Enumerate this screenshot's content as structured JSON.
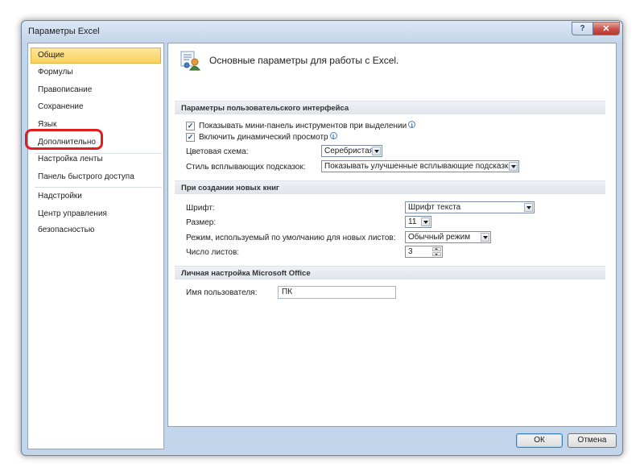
{
  "window": {
    "title": "Параметры Excel",
    "help_label": "?",
    "close_label": "✕"
  },
  "sidebar": {
    "items": [
      {
        "label": "Общие",
        "selected": true
      },
      {
        "label": "Формулы"
      },
      {
        "label": "Правописание"
      },
      {
        "label": "Сохранение"
      },
      {
        "label": "Язык"
      },
      {
        "label": "Дополнительно",
        "highlighted": true
      },
      {
        "label": "Настройка ленты"
      },
      {
        "label": "Панель быстрого доступа"
      },
      {
        "label": "Надстройки"
      },
      {
        "label": "Центр управления безопасностью"
      }
    ]
  },
  "header": {
    "title": "Основные параметры для работы с Excel."
  },
  "ui_section": {
    "title": "Параметры пользовательского интерфейса",
    "mini_toolbar": {
      "label": "Показывать мини-панель инструментов при выделении",
      "checked": true
    },
    "live_preview": {
      "label": "Включить динамический просмотр",
      "checked": true
    },
    "color_scheme": {
      "label": "Цветовая схема:",
      "value": "Серебристая"
    },
    "tooltip_style": {
      "label": "Стиль всплывающих подсказок:",
      "value": "Показывать улучшенные всплывающие подсказки"
    }
  },
  "new_workbook": {
    "title": "При создании новых книг",
    "font": {
      "label": "Шрифт:",
      "value": "Шрифт текста"
    },
    "size": {
      "label": "Размер:",
      "value": "11"
    },
    "default_view": {
      "label": "Режим, используемый по умолчанию для новых листов:",
      "value": "Обычный режим"
    },
    "sheets": {
      "label": "Число листов:",
      "value": "3"
    }
  },
  "personalize": {
    "title": "Личная настройка Microsoft Office",
    "username": {
      "label": "Имя пользователя:",
      "value": "ПК"
    }
  },
  "footer": {
    "ok_label": "ОК",
    "cancel_label": "Отмена"
  },
  "colors": {
    "selection": "#fbd360",
    "highlight_ring": "#e21d1d"
  }
}
